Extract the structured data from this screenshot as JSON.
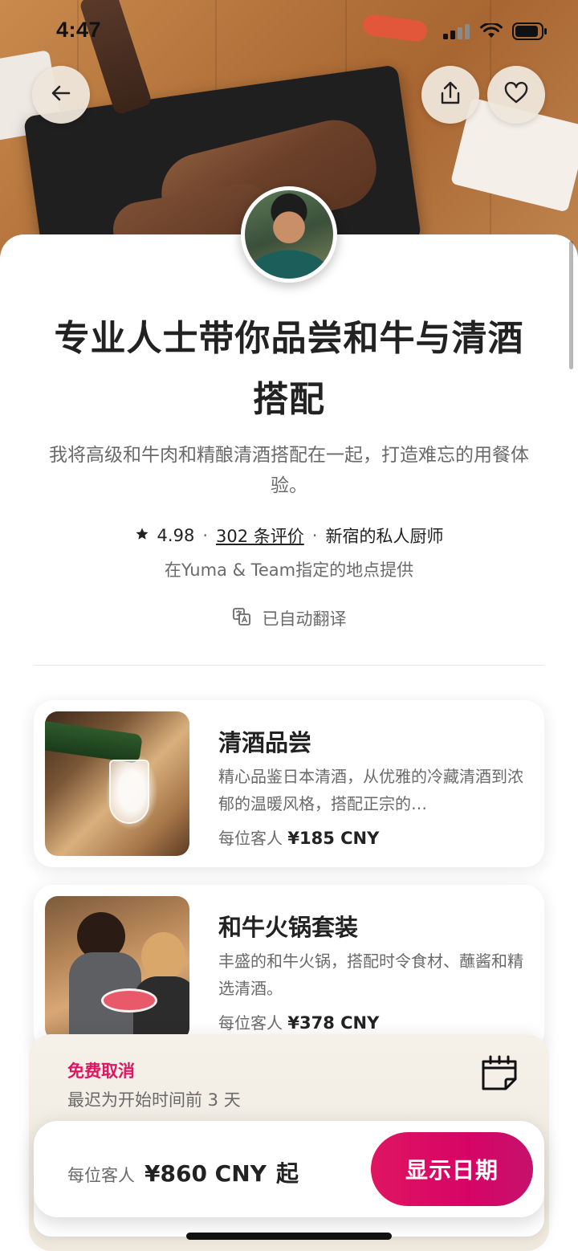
{
  "status_bar": {
    "time": "4:47"
  },
  "header": {
    "back_icon": "arrow-left-icon",
    "share_icon": "share-icon",
    "favorite_icon": "heart-icon"
  },
  "experience": {
    "title_line1": "专业人士带你品尝和牛与清酒",
    "title_line2": "搭配",
    "description": "我将高级和牛肉和精酿清酒搭配在一起，打造难忘的用餐体验。",
    "rating": "4.98",
    "reviews_link": "302 条评价",
    "host_type": "新宿的私人厨师",
    "location": "在Yuma & Team指定的地点提供",
    "translated_label": "已自动翻译"
  },
  "offerings": [
    {
      "title": "清酒品尝",
      "description": "精心品鉴日本清酒，从优雅的冷藏清酒到浓郁的温暖风格，搭配正宗的…",
      "price_prefix": "每位客人",
      "price": "¥185 CNY"
    },
    {
      "title": "和牛火锅套装",
      "description": "丰盛的和牛火锅，搭配时令食材、蘸酱和精选清酒。",
      "price_prefix": "每位客人",
      "price": "¥378 CNY"
    }
  ],
  "cancellation": {
    "title": "免费取消",
    "note": "最迟为开始时间前 3 天"
  },
  "booking": {
    "price_prefix": "每位客人",
    "price": "¥860 CNY",
    "price_suffix": "起",
    "cta_label": "显示日期"
  },
  "colors": {
    "accent": "#E01561",
    "text_primary": "#222222",
    "text_secondary": "#6A6A6A",
    "panel_bg": "#F3EEE6"
  }
}
